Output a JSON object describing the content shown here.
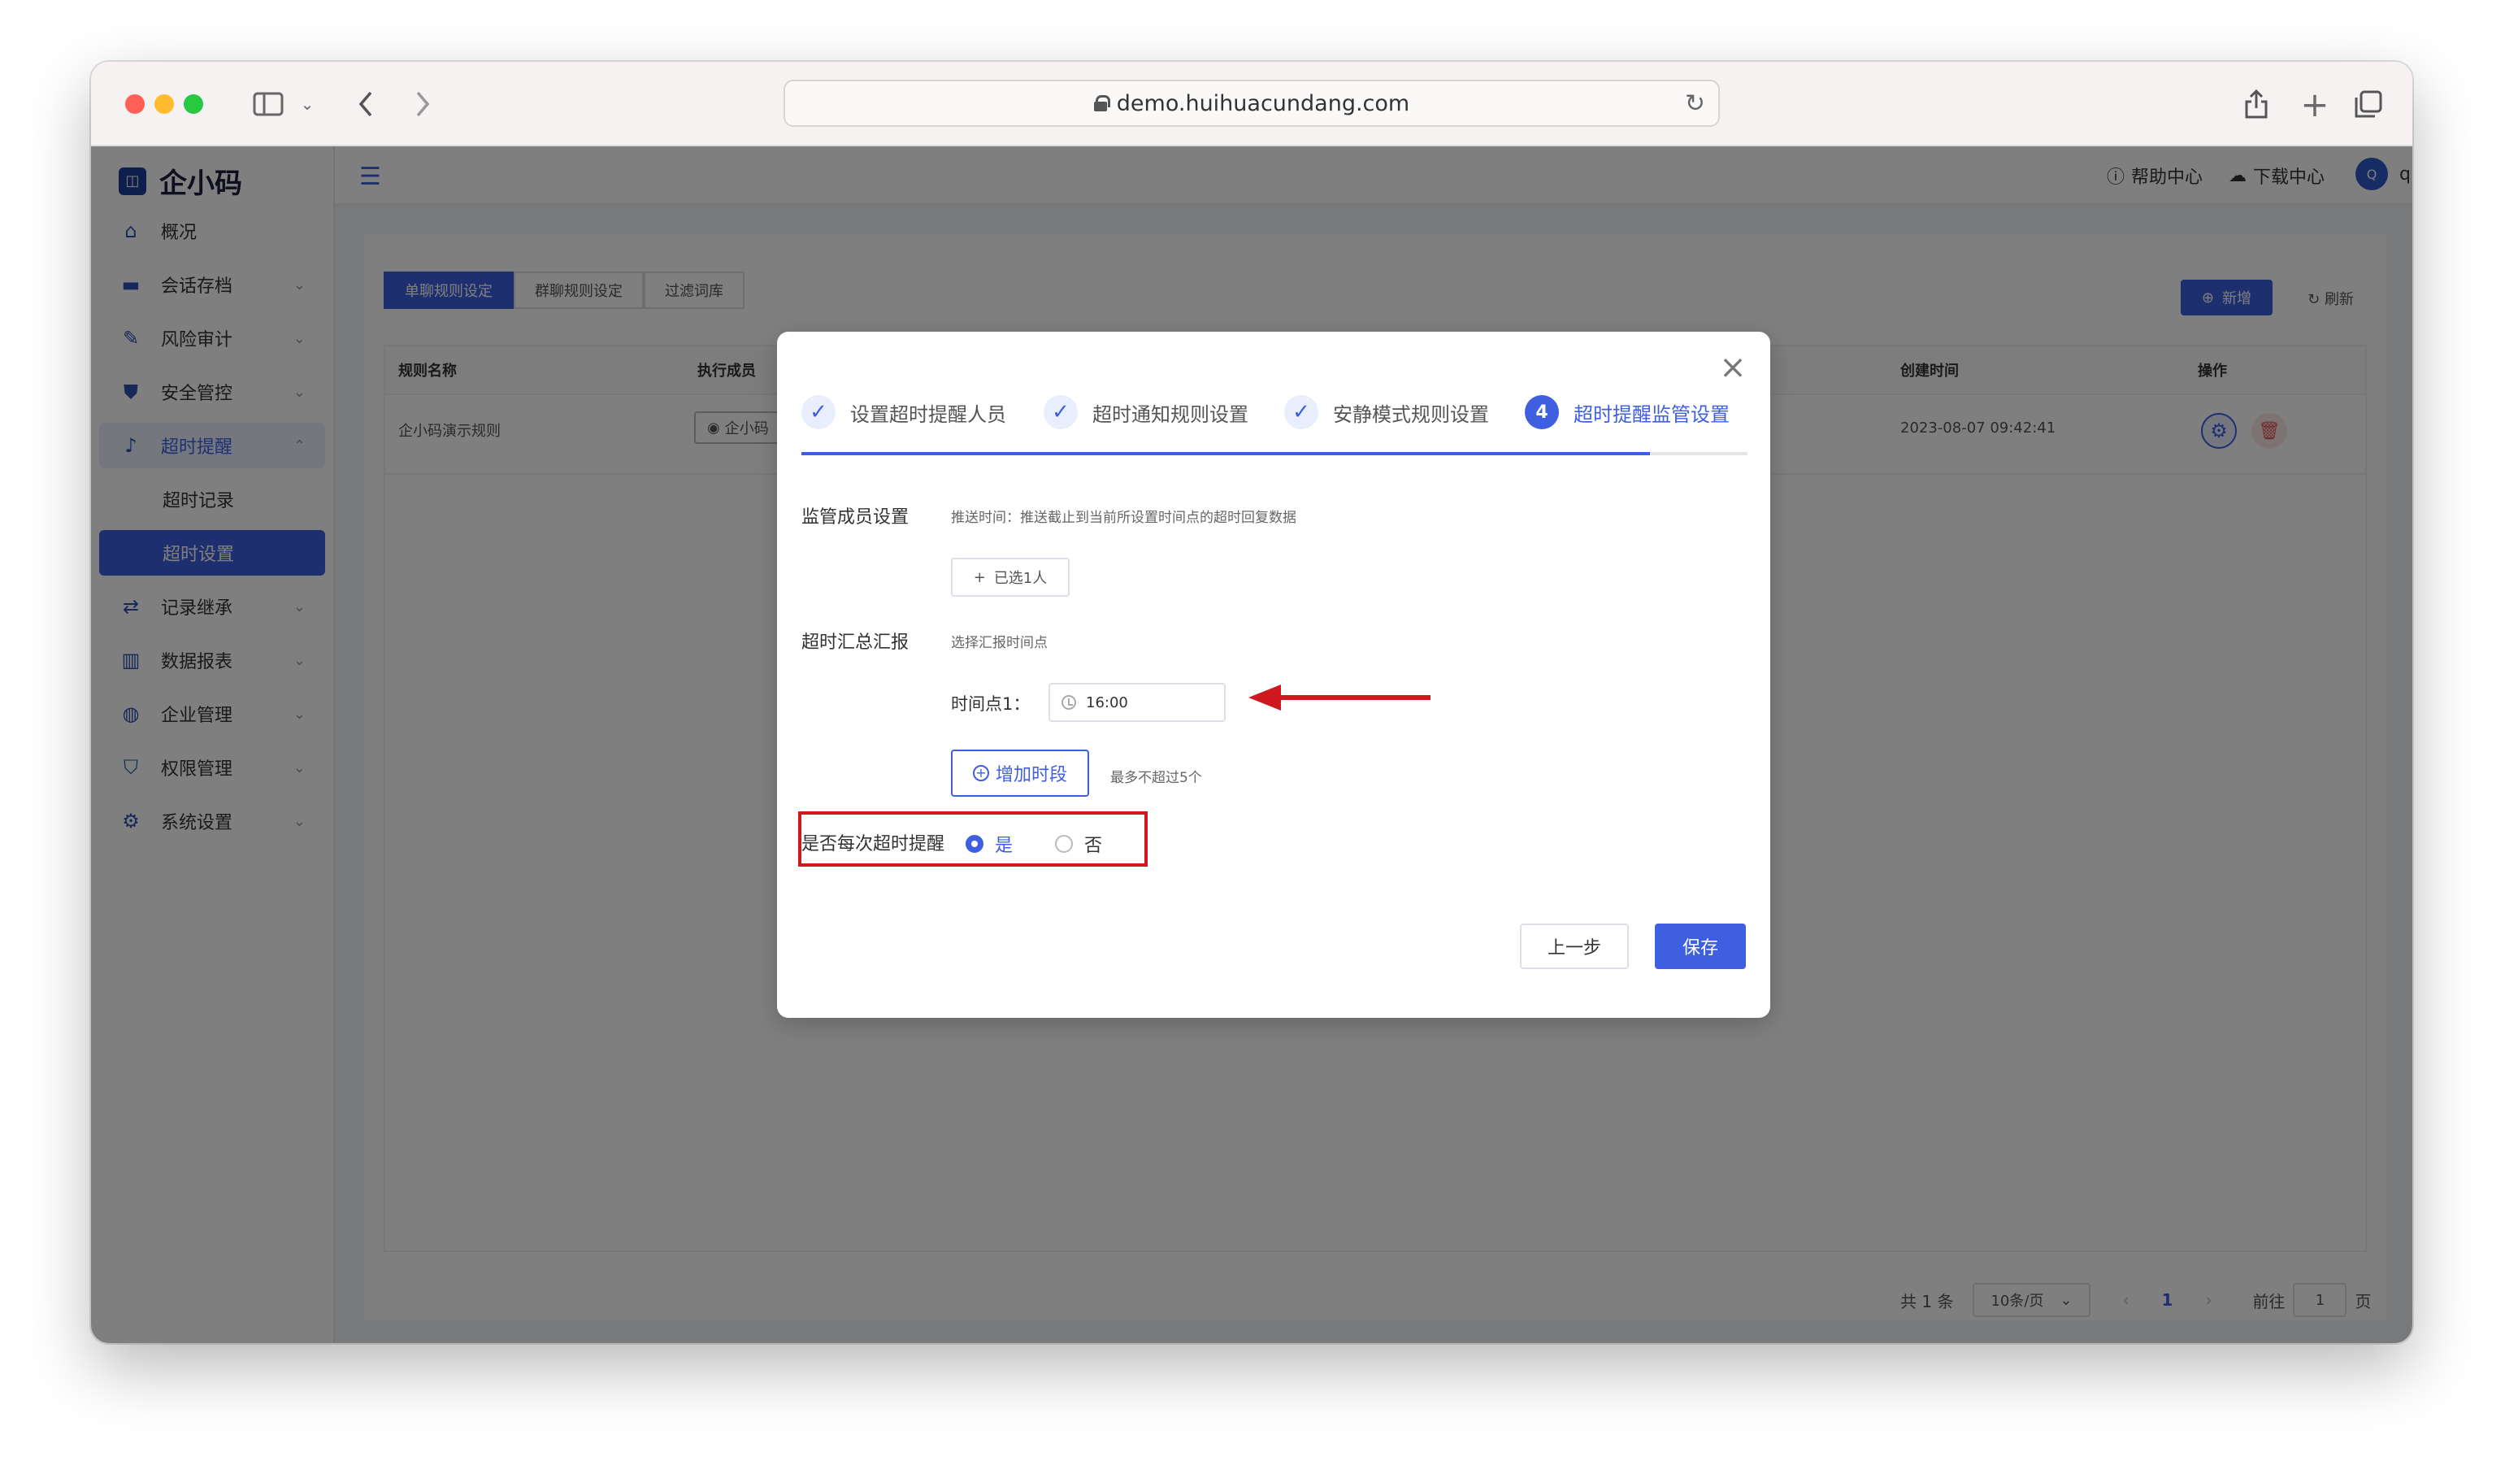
{
  "browser": {
    "url": "demo.huihuacundang.com"
  },
  "app": {
    "logo": "企小码",
    "sidebar": {
      "items": [
        {
          "label": "概况",
          "icon": "home-icon"
        },
        {
          "label": "会话存档",
          "icon": "folder-icon"
        },
        {
          "label": "风险审计",
          "icon": "edit-icon"
        },
        {
          "label": "安全管控",
          "icon": "shield-icon"
        },
        {
          "label": "超时提醒",
          "icon": "bell-icon"
        },
        {
          "label": "超时记录",
          "icon": ""
        },
        {
          "label": "超时设置",
          "icon": ""
        },
        {
          "label": "记录继承",
          "icon": "transfer-icon"
        },
        {
          "label": "数据报表",
          "icon": "chart-icon"
        },
        {
          "label": "企业管理",
          "icon": "globe-icon"
        },
        {
          "label": "权限管理",
          "icon": "lock-icon"
        },
        {
          "label": "系统设置",
          "icon": "gear-icon"
        }
      ]
    },
    "topbar": {
      "help": "帮助中心",
      "download": "下载中心",
      "avatar_letter": "Q",
      "username": "qixiaoma"
    },
    "tabs": [
      "单聊规则设定",
      "群聊规则设定",
      "过滤词库"
    ],
    "actions": {
      "new": "新增",
      "refresh": "刷新"
    },
    "table": {
      "headers": {
        "name": "规则名称",
        "member": "执行成员",
        "created": "创建时间",
        "ops": "操作"
      },
      "row": {
        "name": "企小码演示规则",
        "member": "企小码",
        "created": "2023-08-07 09:42:41"
      }
    },
    "pager": {
      "total": "共 1 条",
      "size": "10条/页",
      "current": "1",
      "goto": "前往",
      "page_input": "1",
      "page_suffix": "页"
    }
  },
  "modal": {
    "steps": [
      {
        "label": "设置超时提醒人员",
        "state": "done"
      },
      {
        "label": "超时通知规则设置",
        "state": "done"
      },
      {
        "label": "安静模式规则设置",
        "state": "done"
      },
      {
        "label": "超时提醒监管设置",
        "state": "current",
        "number": "4"
      }
    ],
    "supervisor_label": "监管成员设置",
    "supervisor_hint": "推送时间：推送截止到当前所设置时间点的超时回复数据",
    "selected_btn": "已选1人",
    "summary_label": "超时汇总汇报",
    "summary_hint": "选择汇报时间点",
    "timepoint_label": "时间点1：",
    "timepoint_value": "16:00",
    "add_period": "增加时段",
    "add_hint": "最多不超过5个",
    "each_timeout_label": "是否每次超时提醒",
    "radio_yes": "是",
    "radio_no": "否",
    "prev_btn": "上一步",
    "save_btn": "保存"
  },
  "colors": {
    "primary": "#3d5fe0",
    "highlight": "#d0191f"
  }
}
